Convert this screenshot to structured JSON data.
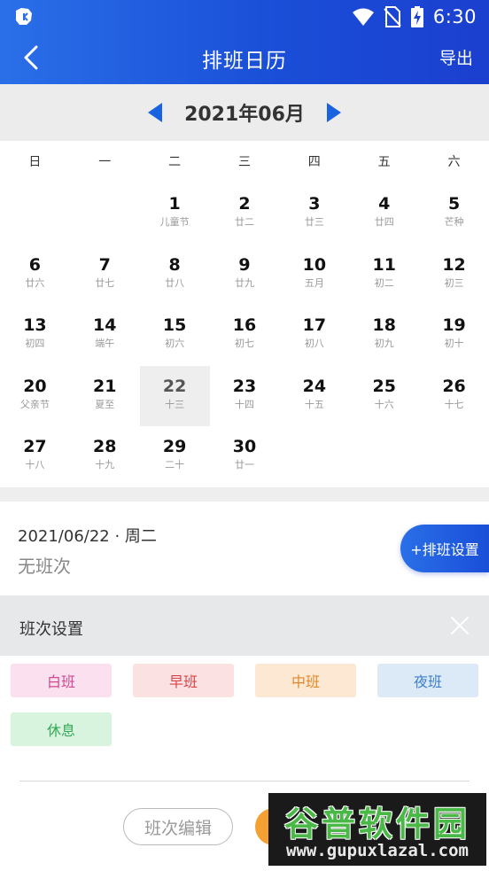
{
  "status_bar": {
    "time": "6:30"
  },
  "nav": {
    "title": "排班日历",
    "export_label": "导出"
  },
  "calendar": {
    "month_label": "2021年06月",
    "weekdays": [
      "日",
      "一",
      "二",
      "三",
      "四",
      "五",
      "六"
    ],
    "days": [
      {
        "day": "1",
        "lunar": "儿童节",
        "col": 2,
        "row": 0
      },
      {
        "day": "2",
        "lunar": "廿二",
        "col": 3,
        "row": 0
      },
      {
        "day": "3",
        "lunar": "廿三",
        "col": 4,
        "row": 0
      },
      {
        "day": "4",
        "lunar": "廿四",
        "col": 5,
        "row": 0
      },
      {
        "day": "5",
        "lunar": "芒种",
        "col": 6,
        "row": 0
      },
      {
        "day": "6",
        "lunar": "廿六",
        "col": 0,
        "row": 1
      },
      {
        "day": "7",
        "lunar": "廿七",
        "col": 1,
        "row": 1
      },
      {
        "day": "8",
        "lunar": "廿八",
        "col": 2,
        "row": 1
      },
      {
        "day": "9",
        "lunar": "廿九",
        "col": 3,
        "row": 1
      },
      {
        "day": "10",
        "lunar": "五月",
        "col": 4,
        "row": 1
      },
      {
        "day": "11",
        "lunar": "初二",
        "col": 5,
        "row": 1
      },
      {
        "day": "12",
        "lunar": "初三",
        "col": 6,
        "row": 1
      },
      {
        "day": "13",
        "lunar": "初四",
        "col": 0,
        "row": 2
      },
      {
        "day": "14",
        "lunar": "端午",
        "col": 1,
        "row": 2
      },
      {
        "day": "15",
        "lunar": "初六",
        "col": 2,
        "row": 2
      },
      {
        "day": "16",
        "lunar": "初七",
        "col": 3,
        "row": 2
      },
      {
        "day": "17",
        "lunar": "初八",
        "col": 4,
        "row": 2
      },
      {
        "day": "18",
        "lunar": "初九",
        "col": 5,
        "row": 2
      },
      {
        "day": "19",
        "lunar": "初十",
        "col": 6,
        "row": 2
      },
      {
        "day": "20",
        "lunar": "父亲节",
        "col": 0,
        "row": 3
      },
      {
        "day": "21",
        "lunar": "夏至",
        "col": 1,
        "row": 3
      },
      {
        "day": "22",
        "lunar": "十三",
        "col": 2,
        "row": 3,
        "selected": true
      },
      {
        "day": "23",
        "lunar": "十四",
        "col": 3,
        "row": 3
      },
      {
        "day": "24",
        "lunar": "十五",
        "col": 4,
        "row": 3
      },
      {
        "day": "25",
        "lunar": "十六",
        "col": 5,
        "row": 3
      },
      {
        "day": "26",
        "lunar": "十七",
        "col": 6,
        "row": 3
      },
      {
        "day": "27",
        "lunar": "十八",
        "col": 0,
        "row": 4
      },
      {
        "day": "28",
        "lunar": "十九",
        "col": 1,
        "row": 4
      },
      {
        "day": "29",
        "lunar": "二十",
        "col": 2,
        "row": 4
      },
      {
        "day": "30",
        "lunar": "廿一",
        "col": 3,
        "row": 4
      }
    ]
  },
  "selected_date": {
    "date_line": "2021/06/22 · 周二",
    "shift_status": "无班次",
    "schedule_button": "+排班设置"
  },
  "shift_panel": {
    "title": "班次设置",
    "shifts": [
      {
        "label": "白班",
        "bg": "#fbe0ef",
        "fg": "#d0488f"
      },
      {
        "label": "早班",
        "bg": "#fbe1e1",
        "fg": "#d9454a"
      },
      {
        "label": "中班",
        "bg": "#fde9d3",
        "fg": "#e2882c"
      },
      {
        "label": "夜班",
        "bg": "#dceaf8",
        "fg": "#3f7fcb"
      },
      {
        "label": "休息",
        "bg": "#d8f4df",
        "fg": "#35a855"
      }
    ],
    "edit_button": "班次编辑"
  },
  "watermark": {
    "logo": "谷普软件园",
    "url": "www.gupuxlazal.com"
  },
  "colors": {
    "brand_blue": "#1a4fd8",
    "accent_orange": "#f5a033"
  }
}
